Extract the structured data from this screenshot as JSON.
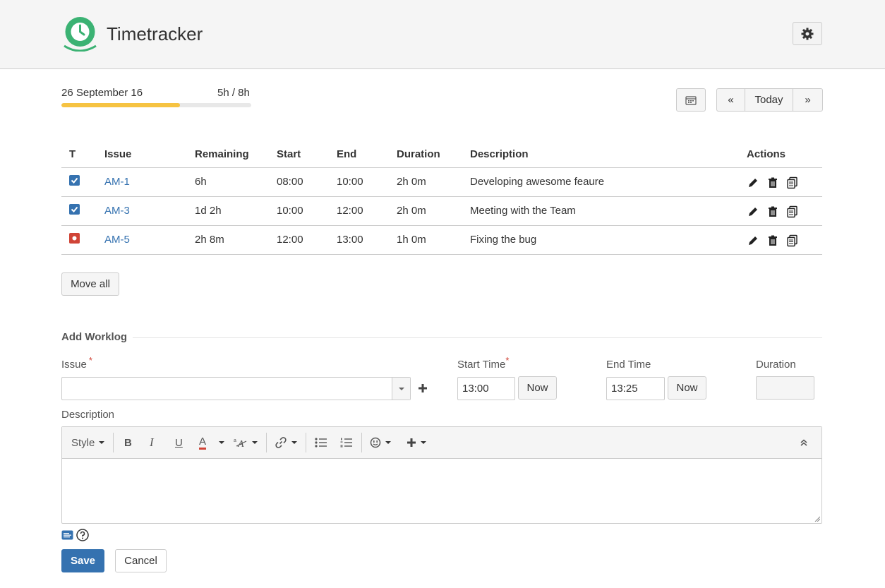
{
  "header": {
    "title": "Timetracker"
  },
  "summary": {
    "date": "26 September 16",
    "hours": "5h / 8h",
    "progress": 0.625
  },
  "nav": {
    "prev": "«",
    "today": "Today",
    "next": "»"
  },
  "table": {
    "columns": [
      "T",
      "Issue",
      "Remaining",
      "Start",
      "End",
      "Duration",
      "Description",
      "Actions"
    ],
    "rows": [
      {
        "type": "task",
        "issue": "AM-1",
        "remaining": "6h",
        "start": "08:00",
        "end": "10:00",
        "duration": "2h 0m",
        "description": "Developing awesome feaure"
      },
      {
        "type": "task",
        "issue": "AM-3",
        "remaining": "1d 2h",
        "start": "10:00",
        "end": "12:00",
        "duration": "2h 0m",
        "description": "Meeting with the Team"
      },
      {
        "type": "bug",
        "issue": "AM-5",
        "remaining": "2h 8m",
        "start": "12:00",
        "end": "13:00",
        "duration": "1h 0m",
        "description": "Fixing the bug"
      }
    ]
  },
  "move_all": "Move all",
  "form": {
    "section_title": "Add Worklog",
    "issue_label": "Issue",
    "required_mark": "*",
    "start_label": "Start Time",
    "end_label": "End Time",
    "duration_label": "Duration",
    "start_value": "13:00",
    "end_value": "13:25",
    "now_label": "Now",
    "description_label": "Description",
    "style_label": "Style",
    "bold": "B",
    "italic": "I",
    "underline": "U",
    "color": "A",
    "save": "Save",
    "cancel": "Cancel"
  },
  "colors": {
    "accent": "#3572b0",
    "progress": "#f6c342",
    "bug": "#d04437",
    "logo": "#3bb273"
  }
}
